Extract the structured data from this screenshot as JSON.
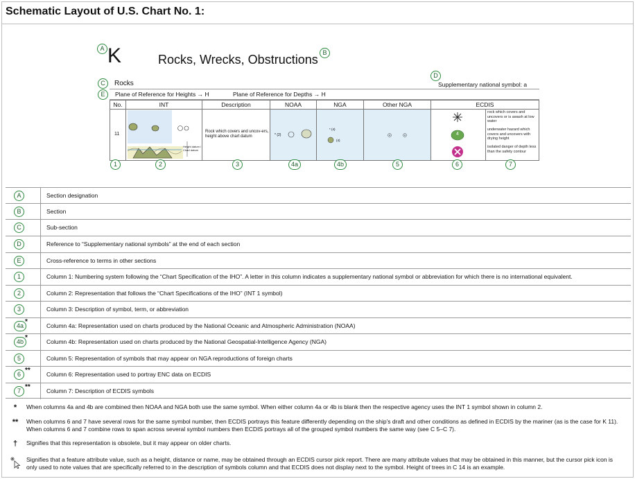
{
  "page_title": "Schematic Layout of U.S. Chart No. 1:",
  "schematic": {
    "section_letter": "K",
    "section_title": "Rocks, Wrecks, Obstructions",
    "subsection": "Rocks",
    "supplementary": "Supplementary national symbol: a",
    "ref_heights": "Plane of Reference for Heights → H",
    "ref_depths": "Plane of Reference for Depths → H",
    "columns": [
      "No.",
      "INT",
      "Description",
      "NOAA",
      "NGA",
      "Other NGA",
      "ECDIS"
    ],
    "row_number": "11",
    "description": "Rock which covers and uncov-ers, height above chart datum",
    "int_side_label": "Height datum / Chart datum",
    "ecdis_notes": [
      "rock which covers and uncovers or is awash at low water",
      "underwater hazard which covers and uncovers with drying height",
      "isolated danger of depth less than the safety contour"
    ],
    "ecdis_value": "4",
    "callouts": {
      "A": "A",
      "B": "B",
      "C": "C",
      "D": "D",
      "E": "E",
      "c1": "1",
      "c2": "2",
      "c3": "3",
      "c4a": "4a",
      "c4b": "4b",
      "c5": "5",
      "c6": "6",
      "c7": "7"
    }
  },
  "legend": [
    {
      "mark": "A",
      "star": "",
      "text": "Section designation"
    },
    {
      "mark": "B",
      "star": "",
      "text": "Section"
    },
    {
      "mark": "C",
      "star": "",
      "text": "Sub-section"
    },
    {
      "mark": "D",
      "star": "",
      "text": "Reference to “Supplementary national symbols” at the end of each section"
    },
    {
      "mark": "E",
      "star": "",
      "text": "Cross-reference to terms in other sections"
    },
    {
      "mark": "1",
      "star": "",
      "text": "Column 1: Numbering system following the “Chart Specification of the IHO”. A letter in this column indicates a supplementary national symbol or abbreviation for which there is no international equivalent."
    },
    {
      "mark": "2",
      "star": "",
      "text": "Column 2: Representation that follows the “Chart Specifications of the IHO” (INT 1 symbol)"
    },
    {
      "mark": "3",
      "star": "",
      "text": "Column 3: Description of symbol, term, or abbreviation"
    },
    {
      "mark": "4a",
      "star": "*",
      "text": "Column 4a: Representation used on charts produced by the National Oceanic and Atmospheric Administration (NOAA)"
    },
    {
      "mark": "4b",
      "star": "*",
      "text": "Column 4b: Representation used on charts produced by the National Geospatial-Intelligence Agency (NGA)"
    },
    {
      "mark": "5",
      "star": "",
      "text": "Column 5: Representation of symbols that may appear on NGA reproductions of foreign charts"
    },
    {
      "mark": "6",
      "star": "**",
      "text": "Column 6: Representation used to portray ENC data on ECDIS"
    },
    {
      "mark": "7",
      "star": "**",
      "text": "Column 7: Description of ECDIS symbols"
    }
  ],
  "notes": [
    {
      "symbol": "*",
      "text": "When columns 4a and 4b are combined then NOAA and NGA both use the same symbol. When either column 4a or 4b is blank then the respective agency uses the INT 1 symbol shown in column 2."
    },
    {
      "symbol": "**",
      "text": "When columns 6 and 7 have several rows for the same symbol number, then ECDIS portrays this feature differently depending on the ship’s draft and other conditions as defined in ECDIS by the mariner (as is the case for K 11). When columns 6 and 7 combine rows to span across several symbol numbers then ECDIS portrays all of the grouped symbol numbers the same way (see C 5–C 7)."
    },
    {
      "symbol": "†",
      "text": "Signifies that this representation is obsolete, but it may appear on older charts."
    },
    {
      "symbol": "cursor-pick-icon",
      "text": "Signifies that a feature attribute value, such as a height, distance or name, may be obtained through an ECDIS cursor pick report. There are many attribute values that may be obtained in this manner, but the cursor pick icon is only used to note values that are specifically referred to in the description of symbols column and that ECDIS does not display next to the symbol. Height of trees in C 14 is an example."
    }
  ]
}
